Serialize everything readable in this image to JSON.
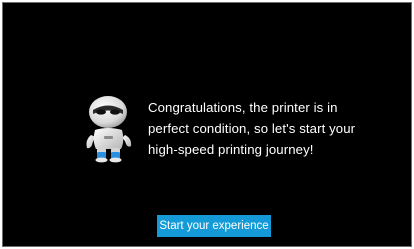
{
  "dialog": {
    "mascot_icon": "robot-mascot-icon",
    "message_lines": [
      "Congratulations, the printer is in",
      "perfect condition, so let's start your",
      "high-speed printing journey!"
    ],
    "start_button_label": "Start your experience"
  },
  "colors": {
    "background": "#000000",
    "text": "#ffffff",
    "button": "#149bd7",
    "accent_blue": "#2a8fe0"
  }
}
